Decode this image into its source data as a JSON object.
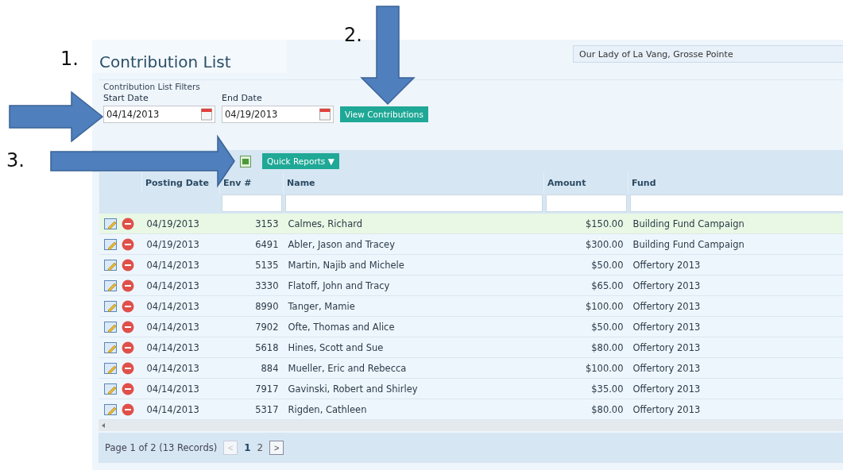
{
  "annotations": [
    {
      "label": "1."
    },
    {
      "label": "2."
    },
    {
      "label": "3."
    }
  ],
  "page_title": "Contribution List",
  "parish": "Our Lady of La Vang, Grosse Pointe",
  "filters": {
    "legend": "Contribution List Filters",
    "start_label": "Start Date",
    "start_value": "04/14/2013",
    "end_label": "End Date",
    "end_value": "04/19/2013",
    "button": "View Contributions"
  },
  "toolbar": {
    "quick_reports": "Quick Reports ▼"
  },
  "table": {
    "columns": [
      "Posting Date",
      "Env #",
      "Name",
      "Amount",
      "Fund"
    ],
    "rows": [
      {
        "selected": true,
        "date": "04/19/2013",
        "env": "3153",
        "name": "Calmes, Richard",
        "amount": "$150.00",
        "fund": "Building Fund Campaign"
      },
      {
        "selected": false,
        "date": "04/19/2013",
        "env": "6491",
        "name": "Abler, Jason and Tracey",
        "amount": "$300.00",
        "fund": "Building Fund Campaign"
      },
      {
        "selected": false,
        "date": "04/14/2013",
        "env": "5135",
        "name": "Martin, Najib and Michele",
        "amount": "$50.00",
        "fund": "Offertory 2013"
      },
      {
        "selected": false,
        "date": "04/14/2013",
        "env": "3330",
        "name": "Flatoff, John and Tracy",
        "amount": "$65.00",
        "fund": "Offertory 2013"
      },
      {
        "selected": false,
        "date": "04/14/2013",
        "env": "8990",
        "name": "Tanger, Mamie",
        "amount": "$100.00",
        "fund": "Offertory 2013"
      },
      {
        "selected": false,
        "date": "04/14/2013",
        "env": "7902",
        "name": "Ofte, Thomas and Alice",
        "amount": "$50.00",
        "fund": "Offertory 2013"
      },
      {
        "selected": false,
        "date": "04/14/2013",
        "env": "5618",
        "name": "Hines, Scott and Sue",
        "amount": "$80.00",
        "fund": "Offertory 2013"
      },
      {
        "selected": false,
        "date": "04/14/2013",
        "env": "884",
        "name": "Mueller, Eric and Rebecca",
        "amount": "$100.00",
        "fund": "Offertory 2013"
      },
      {
        "selected": false,
        "date": "04/14/2013",
        "env": "7917",
        "name": "Gavinski, Robert and Shirley",
        "amount": "$35.00",
        "fund": "Offertory 2013"
      },
      {
        "selected": false,
        "date": "04/14/2013",
        "env": "5317",
        "name": "Rigden, Cathleen",
        "amount": "$80.00",
        "fund": "Offertory 2013"
      }
    ]
  },
  "pager": {
    "summary": "Page 1 of 2 (13 Records)",
    "prev": {
      "label": "<",
      "disabled": true
    },
    "pages": [
      {
        "label": "1",
        "selected": true
      },
      {
        "label": "2",
        "selected": false
      }
    ],
    "next": {
      "label": ">",
      "disabled": false
    }
  }
}
